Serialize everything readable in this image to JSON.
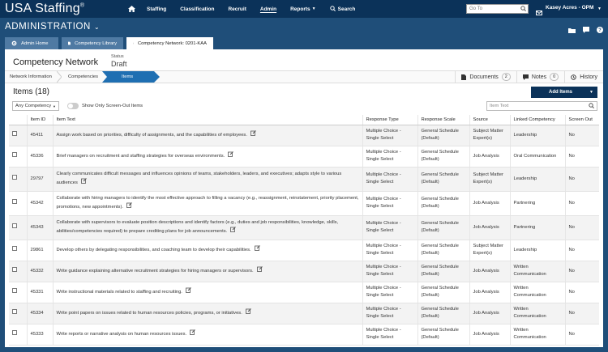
{
  "app": {
    "logo": "USA Staffing",
    "logo_mark": "®"
  },
  "nav": {
    "items": [
      "Staffing",
      "Classification",
      "Recruit",
      "Admin",
      "Reports",
      "Search"
    ],
    "active": "Admin"
  },
  "header": {
    "goto_placeholder": "Go To",
    "user": "Kasey Acres - OPM",
    "section": "ADMINISTRATION"
  },
  "tabs": [
    "Admin Home",
    "Competency Library",
    "Competency Network: 0201-KAA"
  ],
  "page": {
    "title": "Competency Network",
    "status_label": "Status",
    "status_value": "Draft"
  },
  "breadcrumbs": [
    "Network Information",
    "Competencies",
    "Items"
  ],
  "right_tabs": [
    {
      "label": "Documents",
      "count": "2"
    },
    {
      "label": "Notes",
      "count": "0"
    },
    {
      "label": "History",
      "count": ""
    }
  ],
  "items": {
    "title": "Items (18)",
    "add_button": "Add Items",
    "filter_value": "Any Competency",
    "toggle_label": "Show Only Screen-Out Items",
    "search_placeholder": "Item Text"
  },
  "columns": [
    "",
    "Item ID",
    "Item Text",
    "Response Type",
    "Response Scale",
    "Source",
    "Linked Competency",
    "Screen Out"
  ],
  "rows": [
    {
      "id": "45411",
      "text": "Assign work based on priorities, difficulty of assignments, and the capabilities of employees.",
      "rtype": "Multiple Choice - Single Select",
      "scale": "General Schedule (Default)",
      "source": "Subject Matter Expert(s)",
      "comp": "Leadership",
      "screen": "No"
    },
    {
      "id": "45336",
      "text": "Brief managers on recruitment and staffing strategies for overseas environments.",
      "rtype": "Multiple Choice - Single Select",
      "scale": "General Schedule (Default)",
      "source": "Job Analysis",
      "comp": "Oral Communication",
      "screen": "No"
    },
    {
      "id": "29797",
      "text": "Clearly communicates difficult messages and influences opinions of teams, stakeholders, leaders, and executives; adapts style to various audiences",
      "rtype": "Multiple Choice - Single Select",
      "scale": "General Schedule (Default)",
      "source": "Subject Matter Expert(s)",
      "comp": "Leadership",
      "screen": "No"
    },
    {
      "id": "45342",
      "text": "Collaborate with hiring managers to identify the most effective approach to filling a vacancy (e.g., reassignment, reinstatement, priority placement, promotions, new appointments).",
      "rtype": "Multiple Choice - Single Select",
      "scale": "General Schedule (Default)",
      "source": "Job Analysis",
      "comp": "Partnering",
      "screen": "No"
    },
    {
      "id": "45343",
      "text": "Collaborate with supervisors to evaluate position descriptions and identify factors (e.g., duties and job responsibilities, knowledge, skills, abilities/competencies required) to prepare crediting plans for job announcements.",
      "rtype": "Multiple Choice - Single Select",
      "scale": "General Schedule (Default)",
      "source": "Job Analysis",
      "comp": "Partnering",
      "screen": "No"
    },
    {
      "id": "29861",
      "text": "Develop others by delegating responsibilities, and coaching team to develop their capabilities.",
      "rtype": "Multiple Choice - Single Select",
      "scale": "General Schedule (Default)",
      "source": "Subject Matter Expert(s)",
      "comp": "Leadership",
      "screen": "No"
    },
    {
      "id": "45332",
      "text": "Write guidance explaining alternative recruitment strategies for hiring managers or supervisors.",
      "rtype": "Multiple Choice - Single Select",
      "scale": "General Schedule (Default)",
      "source": "Job Analysis",
      "comp": "Written Communication",
      "screen": "No"
    },
    {
      "id": "45331",
      "text": "Write instructional materials related to staffing and recruiting.",
      "rtype": "Multiple Choice - Single Select",
      "scale": "General Schedule (Default)",
      "source": "Job Analysis",
      "comp": "Written Communication",
      "screen": "No"
    },
    {
      "id": "45334",
      "text": "Write point papers on issues related to human resources policies, programs, or initiatives.",
      "rtype": "Multiple Choice - Single Select",
      "scale": "General Schedule (Default)",
      "source": "Job Analysis",
      "comp": "Written Communication",
      "screen": "No"
    },
    {
      "id": "45333",
      "text": "Write reports or narrative analysis on human resources issues.",
      "rtype": "Multiple Choice - Single Select",
      "scale": "General Schedule (Default)",
      "source": "Job Analysis",
      "comp": "Written Communication",
      "screen": "No"
    }
  ],
  "colors": {
    "brand_dark": "#0b3259",
    "brand": "#1f4e79",
    "crumb_active": "#1f6fb2"
  }
}
